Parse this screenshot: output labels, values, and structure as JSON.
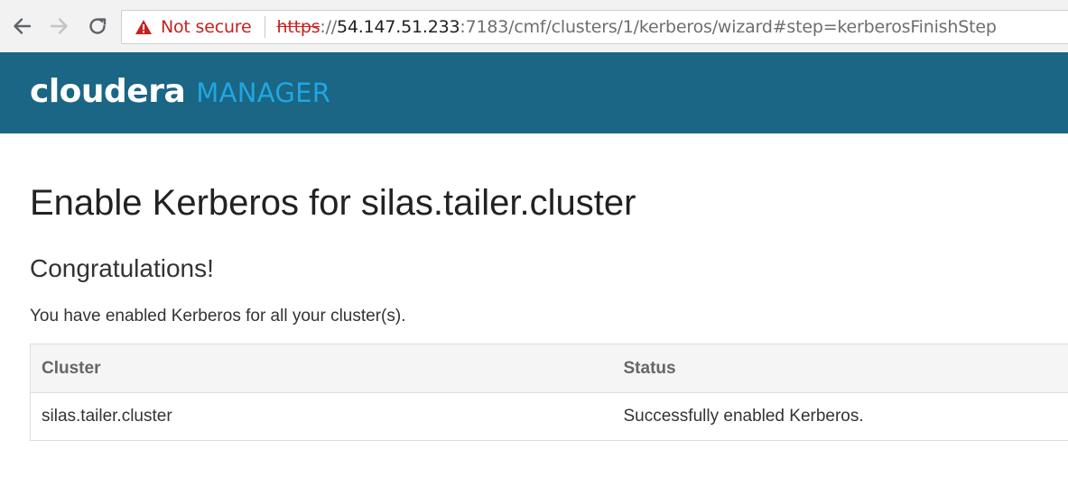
{
  "browser": {
    "security_label": "Not secure",
    "url_scheme": "https",
    "url_separator": "://",
    "url_host": "54.147.51.233",
    "url_rest": ":7183/cmf/clusters/1/kerberos/wizard#step=kerberosFinishStep",
    "icons": {
      "back": "arrow-left-icon",
      "forward": "arrow-right-icon",
      "reload": "reload-icon",
      "warning": "warning-triangle-icon"
    },
    "colors": {
      "warning": "#c5221f"
    }
  },
  "header": {
    "brand": "cloudera",
    "product": "MANAGER",
    "colors": {
      "background": "#1b6585",
      "brand": "#ffffff",
      "product": "#1fa7e0"
    }
  },
  "main": {
    "title": "Enable Kerberos for silas.tailer.cluster",
    "subtitle": "Congratulations!",
    "message": "You have enabled Kerberos for all your cluster(s).",
    "table": {
      "columns": [
        "Cluster",
        "Status"
      ],
      "rows": [
        [
          "silas.tailer.cluster",
          "Successfully enabled Kerberos."
        ]
      ]
    }
  }
}
